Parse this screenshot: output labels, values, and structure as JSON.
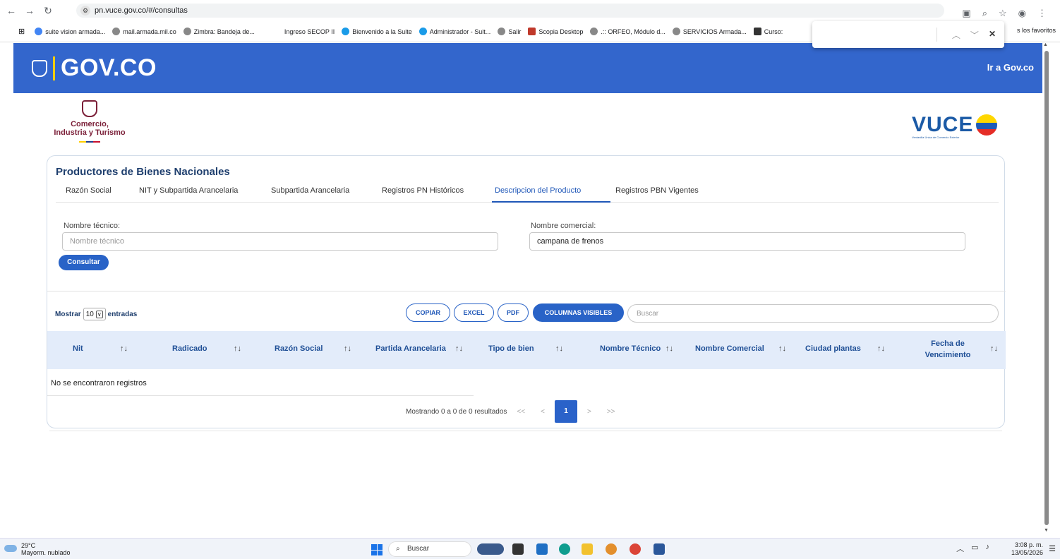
{
  "browser": {
    "url": "pn.vuce.gov.co/#/consultas",
    "bookmarks": [
      "suite vision armada...",
      "mail.armada.mil.co",
      "Zimbra: Bandeja de...",
      "Ingreso SECOP II",
      "Bienvenido a la Suite",
      "Administrador - Suit...",
      "Salir",
      "Scopia Desktop",
      ".:: ORFEO, Módulo d...",
      "SERVICIOS Armada...",
      "Curso:"
    ],
    "bookmarks_right": "s los favoritos"
  },
  "gov": {
    "logo": "GOV.CO",
    "link": "Ir a Gov.co"
  },
  "ministry": {
    "line1": "Comercio,",
    "line2": "Industria y Turismo"
  },
  "vuce": {
    "word": "VUCE",
    "tagline": "Ventanilla Única de Comercio Exterior"
  },
  "card": {
    "title": "Productores de Bienes Nacionales",
    "tabs": [
      "Razón Social",
      "NIT y Subpartida Arancelaria",
      "Subpartida Arancelaria",
      "Registros PN Históricos",
      "Descripcion del Producto",
      "Registros PBN Vigentes"
    ],
    "active_tab": "Descripcion del Producto",
    "form": {
      "tecnico_label": "Nombre técnico:",
      "tecnico_placeholder": "Nombre técnico",
      "comercial_label": "Nombre comercial:",
      "comercial_value": "campana de frenos",
      "submit": "Consultar"
    }
  },
  "table": {
    "show_prefix": "Mostrar",
    "page_size": "10",
    "show_suffix": "entradas",
    "buttons": [
      "COPIAR",
      "EXCEL",
      "PDF",
      "COLUMNAS VISIBLES"
    ],
    "search_placeholder": "Buscar",
    "columns": [
      "Nit",
      "Radicado",
      "Razón Social",
      "Partida Arancelaria",
      "Tipo de bien",
      "Nombre Técnico",
      "Nombre Comercial",
      "Ciudad plantas",
      "Fecha de",
      "Vencimiento"
    ],
    "sort_glyph": "↑↓",
    "empty": "No se encontraron registros",
    "info": "Mostrando 0 a 0 de 0 resultados",
    "pager": {
      "first": "<<",
      "prev": "<",
      "current": "1",
      "next": ">",
      "last": ">>"
    }
  },
  "taskbar": {
    "temp": "29°C",
    "weather": "Mayorm. nublado",
    "search": "Buscar",
    "time": "3:08 p. m.",
    "date": "13/05/2026"
  }
}
